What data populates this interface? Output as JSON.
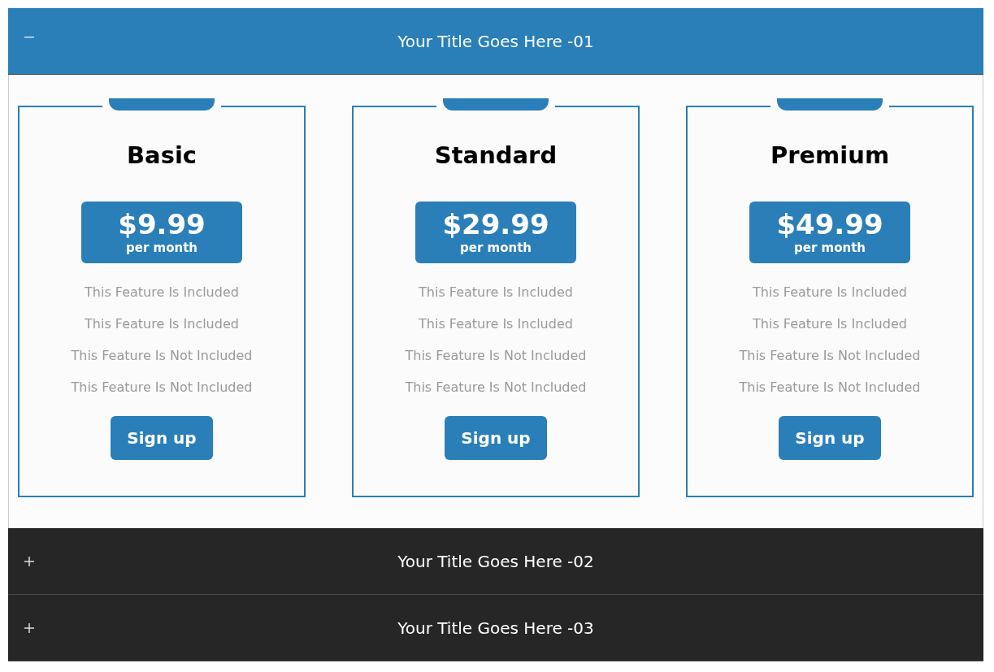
{
  "accordion": [
    {
      "title": "Your Title Goes Here -01",
      "expanded": true,
      "plans": [
        {
          "name": "Basic",
          "price": "$9.99",
          "period": "per month",
          "features": [
            "This Feature Is Included",
            "This Feature Is Included",
            "This Feature Is Not Included",
            "This Feature Is Not Included"
          ],
          "button": "Sign up"
        },
        {
          "name": "Standard",
          "price": "$29.99",
          "period": "per month",
          "features": [
            "This Feature Is Included",
            "This Feature Is Included",
            "This Feature Is Not Included",
            "This Feature Is Not Included"
          ],
          "button": "Sign up"
        },
        {
          "name": "Premium",
          "price": "$49.99",
          "period": "per month",
          "features": [
            "This Feature Is Included",
            "This Feature Is Included",
            "This Feature Is Not Included",
            "This Feature Is Not Included"
          ],
          "button": "Sign up"
        }
      ]
    },
    {
      "title": "Your Title Goes Here -02",
      "expanded": false
    },
    {
      "title": "Your Title Goes Here -03",
      "expanded": false
    }
  ]
}
